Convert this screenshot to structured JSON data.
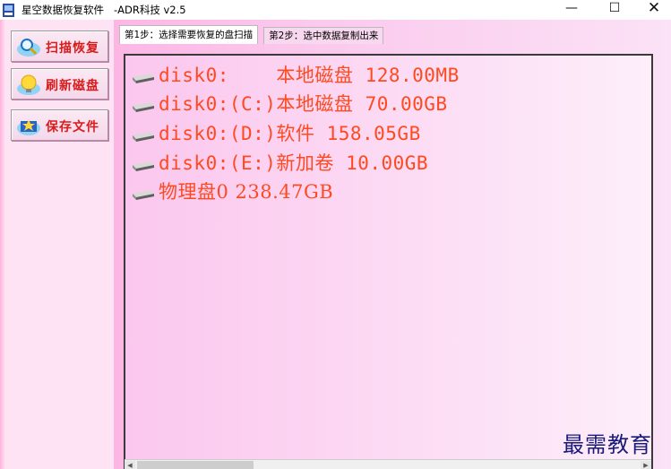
{
  "titlebar": {
    "title": "星空数据恢复软件   -ADR科技 v2.5",
    "minimize_glyph": "—",
    "maximize_glyph": "☐",
    "close_glyph": "✕"
  },
  "sidebar": {
    "buttons": [
      {
        "label": "扫描恢复",
        "icon": "magnifier-icon"
      },
      {
        "label": "刷新磁盘",
        "icon": "lightbulb-icon"
      },
      {
        "label": "保存文件",
        "icon": "save-folder-icon"
      }
    ]
  },
  "tabs": [
    {
      "label": "第1步：选择需要恢复的盘扫描",
      "active": true
    },
    {
      "label": "第2步：选中数据复制出来",
      "active": false
    }
  ],
  "disk_list": {
    "items": [
      {
        "label": "disk0:    本地磁盘 128.00MB"
      },
      {
        "label": "disk0:(C:)本地磁盘 70.00GB"
      },
      {
        "label": "disk0:(D:)软件 158.05GB"
      },
      {
        "label": "disk0:(E:)新加卷 10.00GB"
      },
      {
        "label": "物理盘0 238.47GB"
      }
    ]
  },
  "watermark": "最需教育",
  "colors": {
    "list_text": "#ff4a1f",
    "button_text": "#d81b1b",
    "watermark": "#1a1a7a",
    "panel_pink": "#fdb6e4"
  }
}
